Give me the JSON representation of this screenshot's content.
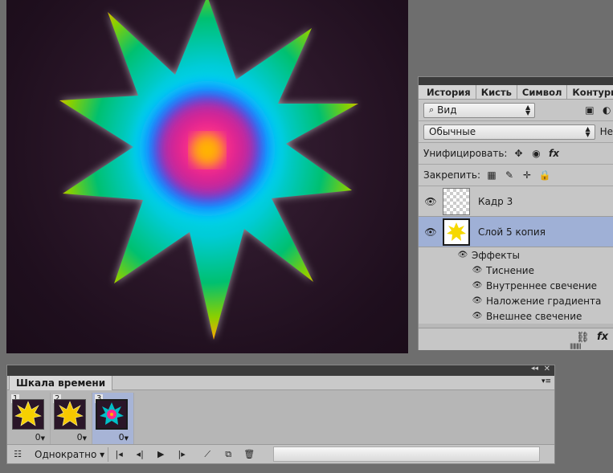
{
  "layers_panel": {
    "tabs": [
      "История",
      "Кисть",
      "Символ",
      "Контуры"
    ],
    "kind_filter": "Вид",
    "blend_mode": "Обычные",
    "opacity_cut": "Не",
    "unify_label": "Унифицировать:",
    "lock_label": "Закрепить:",
    "layers": [
      {
        "name": "Кадр 3",
        "active": false
      },
      {
        "name": "Слой 5 копия",
        "active": true
      }
    ],
    "effects_label": "Эффекты",
    "effects": [
      "Тиснение",
      "Внутреннее свечение",
      "Наложение градиента",
      "Внешнее свечение"
    ]
  },
  "timeline": {
    "title": "Шкала времени",
    "frames": [
      {
        "num": "1",
        "delay": "0"
      },
      {
        "num": "2",
        "delay": "0"
      },
      {
        "num": "3",
        "delay": "0"
      }
    ],
    "active_frame": 3,
    "loop": "Однократно"
  },
  "icons": {
    "eye": "eye-icon",
    "search": "search-icon",
    "fx": "fx-icon",
    "lock": "lock-icon"
  }
}
